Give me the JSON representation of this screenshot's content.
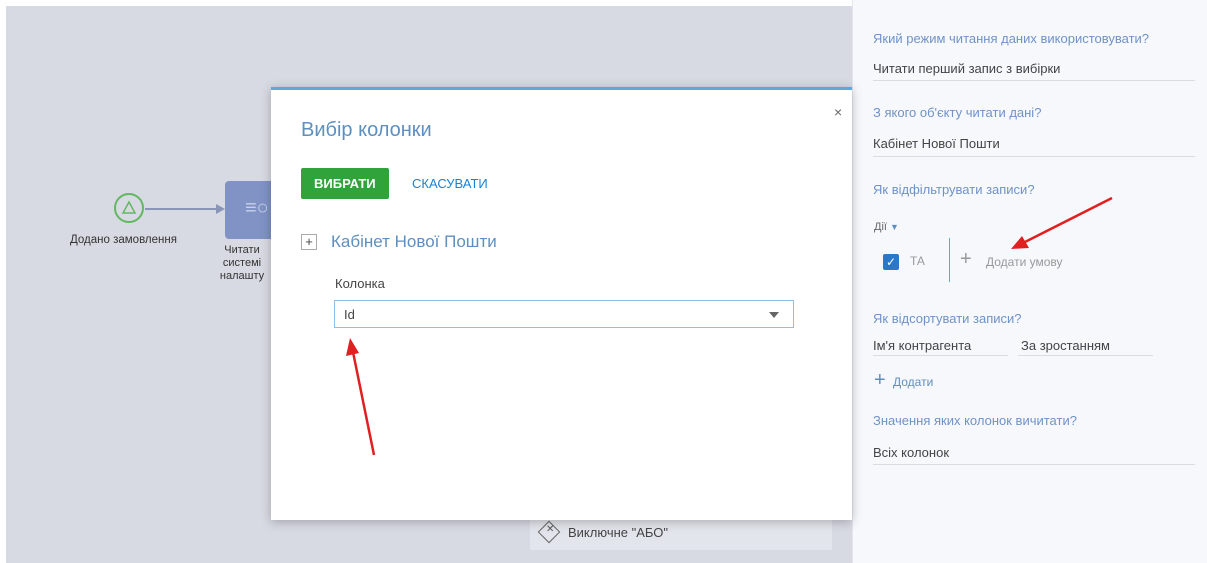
{
  "canvas": {
    "start_event_label": "Додано замовлення",
    "task_label_lines": [
      "Читати",
      "системі",
      "налашту"
    ],
    "gateway_label": "Виключне \"АБО\""
  },
  "panel": {
    "q_read_mode": "Який режим читання даних використовувати?",
    "read_mode_value": "Читати перший запис з вибірки",
    "q_object": "З якого об'єкту читати дані?",
    "object_value": "Кабінет Нової Пошти",
    "q_filter": "Як відфільтрувати записи?",
    "actions_label": "Дії",
    "and_label": "ТА",
    "add_condition_label": "Додати умову",
    "q_sort": "Як відсортувати записи?",
    "sort_column": "Ім'я контрагента",
    "sort_order": "За зростанням",
    "add_label": "Додати",
    "q_columns": "Значення яких колонок вичитати?",
    "columns_value": "Всіх колонок"
  },
  "modal": {
    "title": "Вибір колонки",
    "close_glyph": "×",
    "select_button": "ВИБРАТИ",
    "cancel_button": "СКАСУВАТИ",
    "expand_glyph": "+",
    "section_title": "Кабінет Нової Пошти",
    "column_label": "Колонка",
    "column_value": "Id"
  },
  "colors": {
    "accent_blue": "#5ca8dd",
    "button_green": "#30a43b",
    "annotation_red": "#e02020"
  }
}
